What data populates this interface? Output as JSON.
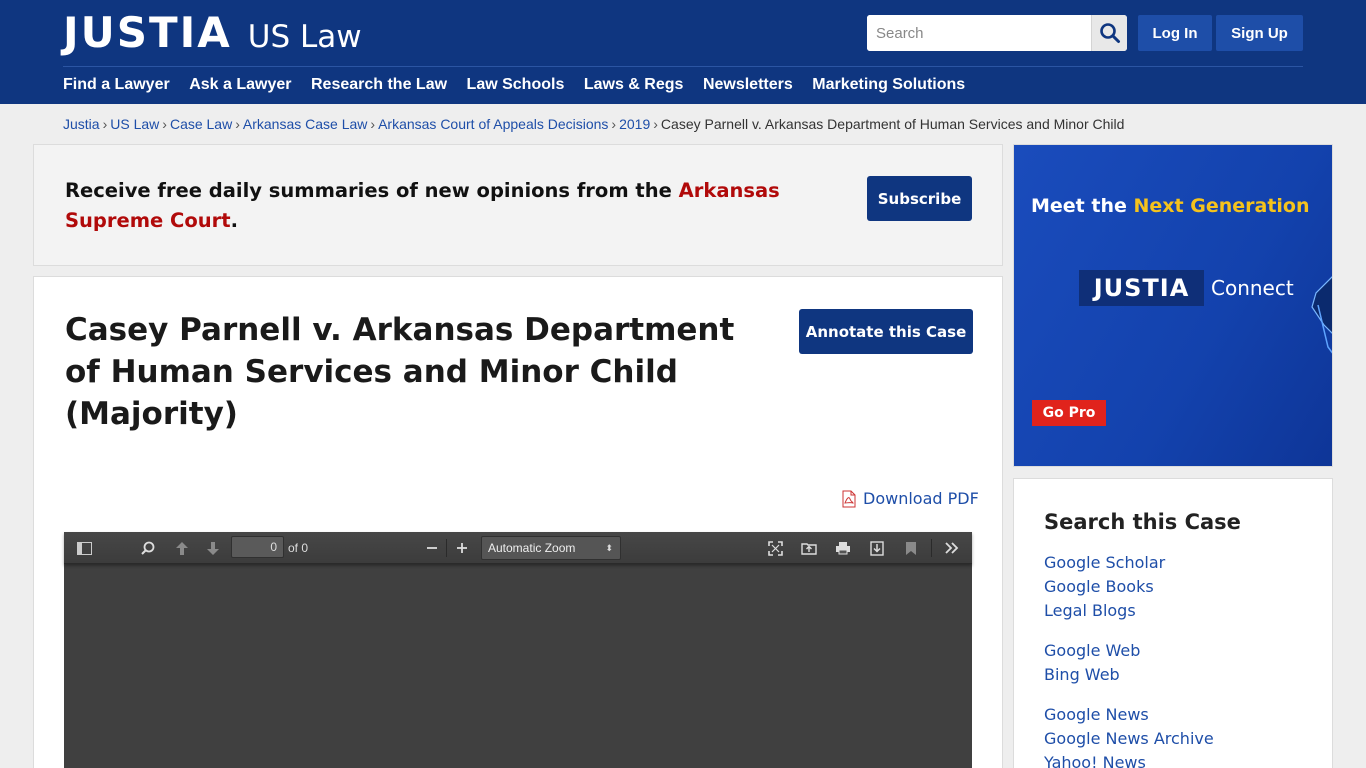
{
  "header": {
    "logo_main": "JUSTIA",
    "logo_sub": "US Law",
    "search_placeholder": "Search",
    "login_label": "Log In",
    "signup_label": "Sign Up",
    "nav": [
      "Find a Lawyer",
      "Ask a Lawyer",
      "Research the Law",
      "Law Schools",
      "Laws & Regs",
      "Newsletters",
      "Marketing Solutions"
    ]
  },
  "breadcrumb": {
    "items": [
      "Justia",
      "US Law",
      "Case Law",
      "Arkansas Case Law",
      "Arkansas Court of Appeals Decisions",
      "2019"
    ],
    "separator": "›",
    "current": "Casey Parnell v. Arkansas Department of Human Services and Minor Child"
  },
  "subscribe": {
    "text_before": "Receive free daily summaries of new opinions from the ",
    "court": "Arkansas Supreme Court",
    "text_after": ".",
    "button": "Subscribe"
  },
  "case": {
    "title": "Casey Parnell v. Arkansas Department of Human Services and Minor Child (Majority)",
    "annotate_button": "Annotate this Case",
    "download_label": "Download PDF"
  },
  "pdf_viewer": {
    "page_value": "0",
    "page_of": "of 0",
    "zoom": "Automatic Zoom"
  },
  "ad": {
    "headline_before": "Meet the ",
    "headline_highlight": "Next Generation",
    "logo": "JUSTIA",
    "connect": "Connect",
    "cta": "Go Pro"
  },
  "search_case": {
    "title": "Search this Case",
    "groups": [
      [
        "Google Scholar",
        "Google Books",
        "Legal Blogs"
      ],
      [
        "Google Web",
        "Bing Web"
      ],
      [
        "Google News",
        "Google News Archive",
        "Yahoo! News"
      ]
    ]
  },
  "colors": {
    "brand_navy": "#0f3680",
    "link_blue": "#1e4ea8",
    "court_red": "#b10a0a",
    "ad_yellow": "#f5c31c",
    "go_pro_red": "#e0231c"
  }
}
